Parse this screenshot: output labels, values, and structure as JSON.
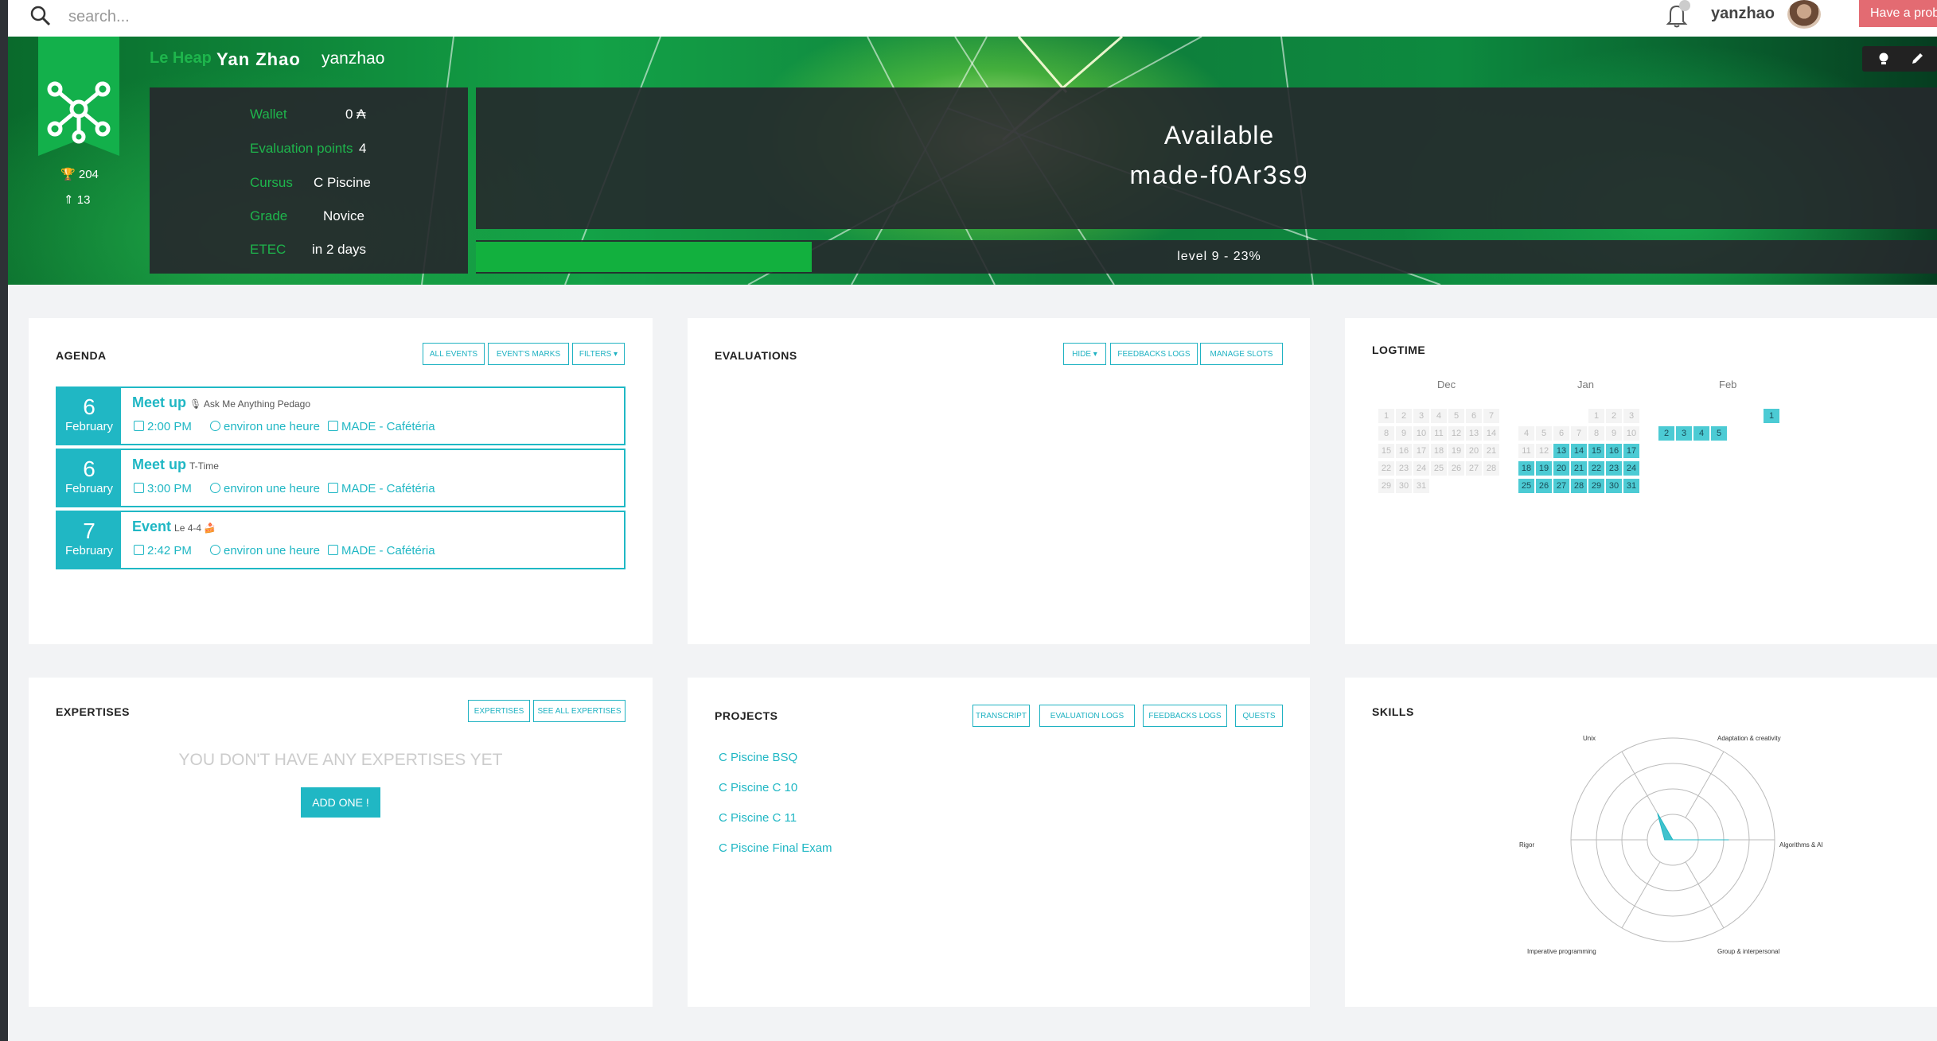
{
  "search": {
    "placeholder": "search..."
  },
  "user": {
    "login": "yanzhao",
    "problem_button": "Have a problem?"
  },
  "profile": {
    "coalition_prefix": "Le Heap",
    "full_name": "Yan Zhao",
    "login": "yanzhao",
    "trophies": "204",
    "achievements": "13",
    "wallet_label": "Wallet",
    "wallet_value": "0 ₳",
    "eval_label": "Evaluation points",
    "eval_value": "4",
    "cursus_label": "Cursus",
    "cursus_value": "C Piscine",
    "grade_label": "Grade",
    "grade_value": "Novice",
    "etec_label": "ETEC",
    "etec_value": "in 2 days",
    "availability": "Available",
    "host": "made-f0Ar3s9",
    "level_text": "level 9 - 23%",
    "level_progress": 0.23
  },
  "agenda": {
    "title": "AGENDA",
    "buttons": [
      "ALL EVENTS",
      "EVENT'S MARKS",
      "FILTERS ▾"
    ],
    "events": [
      {
        "day": "6",
        "month": "February",
        "title": "Meet up",
        "subtitle": "🎙 Ask Me Anything Pedago",
        "time": "2:00 PM",
        "duration": "environ une heure",
        "location": "MADE - Cafétéria"
      },
      {
        "day": "6",
        "month": "February",
        "title": "Meet up",
        "subtitle": "T-Time",
        "time": "3:00 PM",
        "duration": "environ une heure",
        "location": "MADE - Cafétéria"
      },
      {
        "day": "7",
        "month": "February",
        "title": "Event",
        "subtitle": "Le 4-4 🍰",
        "time": "2:42 PM",
        "duration": "environ une heure",
        "location": "MADE - Cafétéria"
      }
    ]
  },
  "evaluations": {
    "title": "EVALUATIONS",
    "buttons": [
      "HIDE ▾",
      "FEEDBACKS LOGS",
      "MANAGE SLOTS"
    ]
  },
  "logtime": {
    "title": "LOGTIME",
    "months": [
      "Dec",
      "Jan",
      "Feb"
    ],
    "dec": [
      "1",
      "2",
      "3",
      "4",
      "5",
      "6",
      "7",
      "8",
      "9",
      "10",
      "11",
      "12",
      "13",
      "14",
      "15",
      "16",
      "17",
      "18",
      "19",
      "20",
      "21",
      "22",
      "23",
      "24",
      "25",
      "26",
      "27",
      "28",
      "29",
      "30",
      "31"
    ],
    "jan": [
      "1",
      "2",
      "3",
      "4",
      "5",
      "6",
      "7",
      "8",
      "9",
      "10",
      "11",
      "12",
      "13",
      "14",
      "15",
      "16",
      "17",
      "18",
      "19",
      "20",
      "21",
      "22",
      "23",
      "24",
      "25",
      "26",
      "27",
      "28",
      "29",
      "30",
      "31"
    ],
    "feb": [
      "1",
      "2",
      "3",
      "4",
      "5"
    ],
    "jan_active": [
      "13",
      "14",
      "15",
      "16",
      "17",
      "18",
      "19",
      "20",
      "21",
      "22",
      "23",
      "24",
      "25",
      "26",
      "27",
      "28",
      "29",
      "30",
      "31"
    ],
    "feb_active": [
      "1",
      "2",
      "3",
      "4",
      "5"
    ]
  },
  "expertises": {
    "title": "EXPERTISES",
    "buttons": [
      "EXPERTISES",
      "SEE ALL EXPERTISES"
    ],
    "empty": "YOU DON'T HAVE ANY EXPERTISES YET",
    "add": "ADD ONE !"
  },
  "projects": {
    "title": "PROJECTS",
    "buttons": [
      "TRANSCRIPT",
      "EVALUATION LOGS",
      "FEEDBACKS LOGS",
      "QUESTS"
    ],
    "items": [
      "C Piscine BSQ",
      "C Piscine C 10",
      "C Piscine C 11",
      "C Piscine Final Exam"
    ]
  },
  "skills": {
    "title": "SKILLS",
    "labels": [
      "Unix",
      "Adaptation & creativity",
      "Algorithms & AI",
      "Group & interpersonal",
      "Imperative programming",
      "Rigor"
    ],
    "values": [
      0.3,
      0.0,
      0.55,
      0.0,
      0.0,
      0.08
    ],
    "accent": "#20b7c4"
  },
  "colors": {
    "accent": "#20b7c4",
    "coalition": "#13b04b",
    "problem": "#e36b72"
  }
}
